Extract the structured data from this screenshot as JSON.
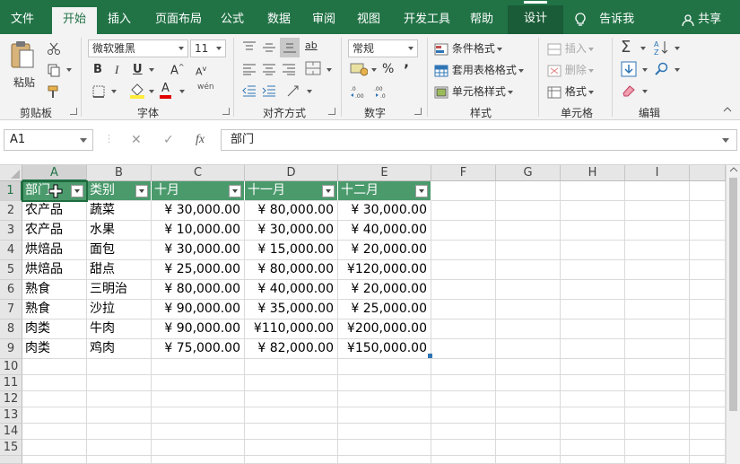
{
  "ribbon_tabs": [
    {
      "label": "文件"
    },
    {
      "label": "开始"
    },
    {
      "label": "插入"
    },
    {
      "label": "页面布局"
    },
    {
      "label": "公式"
    },
    {
      "label": "数据"
    },
    {
      "label": "审阅"
    },
    {
      "label": "视图"
    },
    {
      "label": "开发工具"
    },
    {
      "label": "帮助"
    },
    {
      "label": "设计"
    }
  ],
  "tell_me": "告诉我",
  "share": "共享",
  "clipboard": {
    "paste": "粘贴",
    "group": "剪贴板"
  },
  "font": {
    "name": "微软雅黑",
    "size": "11",
    "group": "字体",
    "bold": "B",
    "italic": "I",
    "underline": "U",
    "grow": "A",
    "shrink": "A",
    "fill_letter": "A",
    "phonetic": "wén"
  },
  "alignment": {
    "group": "对齐方式",
    "wrap": "ab"
  },
  "number": {
    "format": "常规",
    "group": "数字",
    "percent": "%",
    "comma": "’"
  },
  "styles": {
    "conditional": "条件格式",
    "table": "套用表格格式",
    "cell": "单元格样式",
    "group": "样式"
  },
  "cells": {
    "insert": "插入",
    "delete": "删除",
    "format": "格式",
    "group": "单元格"
  },
  "editing": {
    "group": "编辑",
    "sum": "Σ"
  },
  "formula_bar": {
    "name_box": "A1",
    "fx": "fx",
    "content": "部门",
    "cancel": "✕",
    "confirm": "✓"
  },
  "columns": [
    "A",
    "B",
    "C",
    "D",
    "E",
    "F",
    "G",
    "H",
    "I"
  ],
  "rows": [
    "1",
    "2",
    "3",
    "4",
    "5",
    "6",
    "7",
    "8",
    "9",
    "10",
    "11",
    "12",
    "13",
    "14",
    "15"
  ],
  "table": {
    "headers": [
      "部门",
      "类别",
      "十月",
      "十一月",
      "十二月"
    ],
    "rows": [
      [
        "农产品",
        "蔬菜",
        "¥  30,000.00",
        "¥  80,000.00",
        "¥  30,000.00"
      ],
      [
        "农产品",
        "水果",
        "¥  10,000.00",
        "¥  30,000.00",
        "¥  40,000.00"
      ],
      [
        "烘焙品",
        "面包",
        "¥  30,000.00",
        "¥  15,000.00",
        "¥  20,000.00"
      ],
      [
        "烘焙品",
        "甜点",
        "¥  25,000.00",
        "¥  80,000.00",
        "¥120,000.00"
      ],
      [
        "熟食",
        "三明治",
        "¥  80,000.00",
        "¥  40,000.00",
        "¥  20,000.00"
      ],
      [
        "熟食",
        "沙拉",
        "¥  90,000.00",
        "¥  35,000.00",
        "¥  25,000.00"
      ],
      [
        "肉类",
        "牛肉",
        "¥  90,000.00",
        "¥110,000.00",
        "¥200,000.00"
      ],
      [
        "肉类",
        "鸡肉",
        "¥  75,000.00",
        "¥  82,000.00",
        "¥150,000.00"
      ]
    ]
  },
  "colors": {
    "brand": "#217346",
    "table_header": "#4a9a6c"
  }
}
